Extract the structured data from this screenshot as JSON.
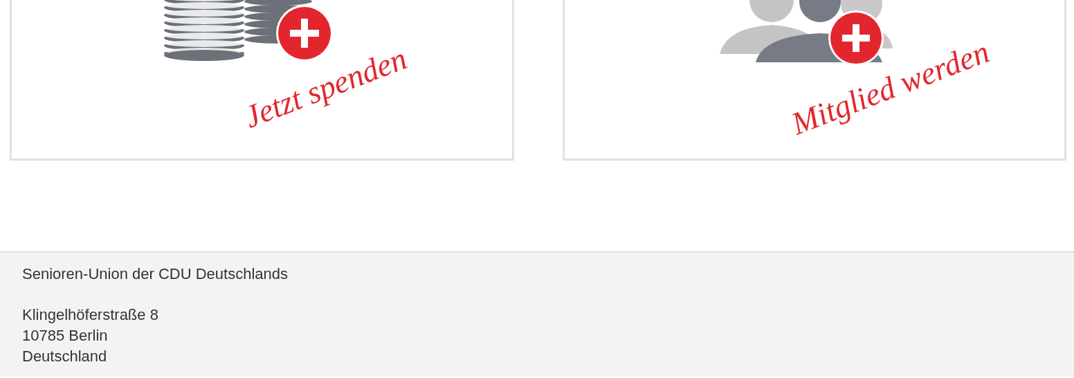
{
  "cards": [
    {
      "kind": "donate",
      "label": "Jetzt spenden"
    },
    {
      "kind": "member",
      "label": "Mitglied werden"
    }
  ],
  "footer": {
    "organization": "Senioren-Union der CDU Deutschlands",
    "address": [
      "Klingelhöferstraße 8",
      "10785 Berlin",
      "Deutschland"
    ]
  }
}
